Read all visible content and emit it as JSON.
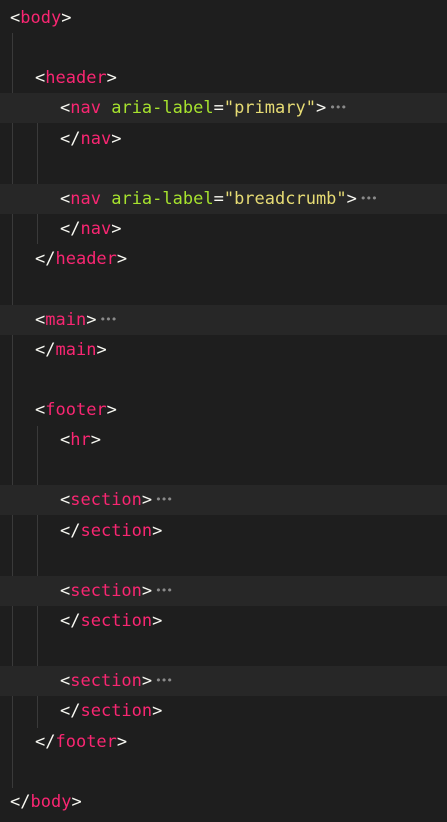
{
  "editor": {
    "colors": {
      "background": "#1e1e1e",
      "folded_line_background": "#272727",
      "tag": "#f92672",
      "punctuation": "#f8f8f2",
      "attribute": "#a6e22e",
      "string": "#e6db74",
      "fold_marker": "#8a8a8a",
      "indent_guide": "#3a3a3a"
    },
    "fold_marker_icon": "ellipsis-icon",
    "lines": [
      {
        "open": "<",
        "tag": "body",
        "close": ">"
      },
      {
        "blank": true
      },
      {
        "open": "<",
        "tag": "header",
        "close": ">"
      },
      {
        "open": "<",
        "tag": "nav",
        "attr": "aria-label",
        "eq": "=",
        "value": "\"primary\"",
        "close": ">",
        "folded": true
      },
      {
        "open": "</",
        "tag": "nav",
        "close": ">"
      },
      {
        "blank": true
      },
      {
        "open": "<",
        "tag": "nav",
        "attr": "aria-label",
        "eq": "=",
        "value": "\"breadcrumb\"",
        "close": ">",
        "folded": true
      },
      {
        "open": "</",
        "tag": "nav",
        "close": ">"
      },
      {
        "open": "</",
        "tag": "header",
        "close": ">"
      },
      {
        "blank": true
      },
      {
        "open": "<",
        "tag": "main",
        "close": ">",
        "folded": true
      },
      {
        "open": "</",
        "tag": "main",
        "close": ">"
      },
      {
        "blank": true
      },
      {
        "open": "<",
        "tag": "footer",
        "close": ">"
      },
      {
        "open": "<",
        "tag": "hr",
        "close": ">"
      },
      {
        "blank": true
      },
      {
        "open": "<",
        "tag": "section",
        "close": ">",
        "folded": true
      },
      {
        "open": "</",
        "tag": "section",
        "close": ">"
      },
      {
        "blank": true
      },
      {
        "open": "<",
        "tag": "section",
        "close": ">",
        "folded": true
      },
      {
        "open": "</",
        "tag": "section",
        "close": ">"
      },
      {
        "blank": true
      },
      {
        "open": "<",
        "tag": "section",
        "close": ">",
        "folded": true
      },
      {
        "open": "</",
        "tag": "section",
        "close": ">"
      },
      {
        "open": "</",
        "tag": "footer",
        "close": ">"
      },
      {
        "blank": true
      },
      {
        "open": "</",
        "tag": "body",
        "close": ">"
      }
    ]
  }
}
